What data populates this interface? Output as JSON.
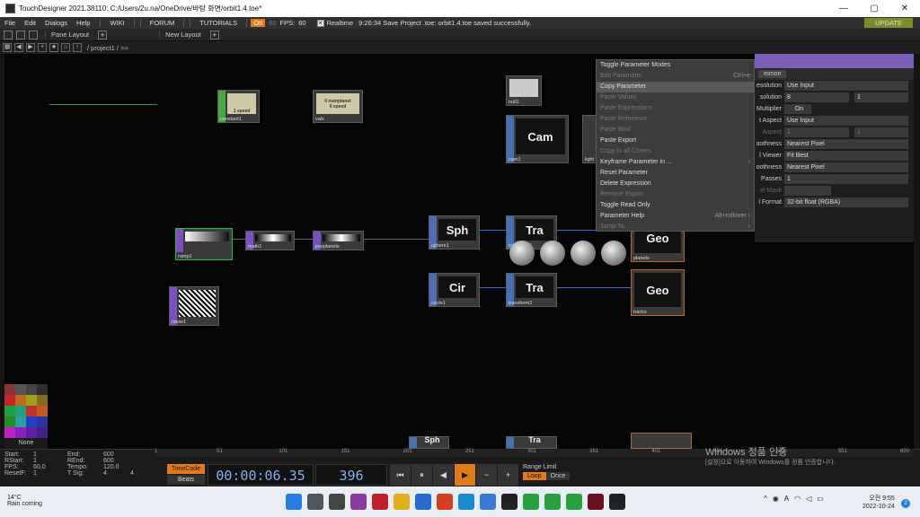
{
  "window": {
    "title": "TouchDesigner 2021.38110: C:/Users/2u.na/OneDrive/바탕 화면/orbit1.4.toe*"
  },
  "menu": {
    "items": [
      "File",
      "Edit",
      "Dialogs",
      "Help"
    ],
    "links": [
      "WIKI",
      "FORUM",
      "TUTORIALS"
    ],
    "oii": "OII",
    "fps_left": "60",
    "fps_label": "FPS:",
    "fps_value": "60",
    "realtime": "Realtime",
    "status": "9:26:34 Save Project .toe: orbit1.4.toe saved successfully.",
    "update": "UPDATE"
  },
  "panebar": {
    "pane_layout": "Pane Layout",
    "new_layout": "New Layout"
  },
  "pathbar": {
    "path": "/ project1 / >>"
  },
  "nodes": {
    "constant": "constant1",
    "vals": "vals",
    "null": "null1",
    "cam_thumb": "Cam",
    "cam": "cam1",
    "light": "light",
    "ramp": "ramp1",
    "math": "math1",
    "posplanets": "posplanets",
    "sph_thumb": "Sph",
    "sphere": "sphere1",
    "tra_thumb": "Tra",
    "transform1": "transform1",
    "geo_thumb": "Geo",
    "planets": "planets",
    "noise": "noise1",
    "cir_thumb": "Cir",
    "circle": "circle1",
    "transform2": "transform2",
    "tracks": "tracks",
    "constant_p1": "1 speed",
    "vals_p1": "0 numplanet",
    "vals_p2": "0 speed"
  },
  "context_menu": [
    {
      "label": "Toggle Parameter Modes",
      "enabled": true,
      "shortcut": ""
    },
    {
      "label": "Edit Parameter",
      "enabled": false,
      "shortcut": "Ctrl+e"
    },
    {
      "label": "Copy Parameter",
      "enabled": true,
      "shortcut": ""
    },
    {
      "label": "Paste Values",
      "enabled": false,
      "shortcut": ""
    },
    {
      "label": "Paste Expressions",
      "enabled": false,
      "shortcut": ""
    },
    {
      "label": "Paste Reference",
      "enabled": false,
      "shortcut": ""
    },
    {
      "label": "Paste Bind",
      "enabled": false,
      "shortcut": ""
    },
    {
      "label": "Paste Export",
      "enabled": true,
      "shortcut": ""
    },
    {
      "label": "Copy to all Clones",
      "enabled": false,
      "shortcut": ""
    },
    {
      "label": "Keyframe Parameter in ...",
      "enabled": true,
      "shortcut": "›"
    },
    {
      "label": "Reset Parameter",
      "enabled": true,
      "shortcut": ""
    },
    {
      "label": "Delete Expression",
      "enabled": true,
      "shortcut": ""
    },
    {
      "label": "Remove Export",
      "enabled": false,
      "shortcut": ""
    },
    {
      "label": "Toggle Read Only",
      "enabled": true,
      "shortcut": ""
    },
    {
      "label": "Parameter Help",
      "enabled": true,
      "shortcut": "Alt+rollover ›"
    },
    {
      "label": "Jump To...",
      "enabled": false,
      "shortcut": "›"
    }
  ],
  "params": {
    "tab": "mmon",
    "rows": [
      {
        "label": "esolution",
        "value": "Use Input",
        "enabled": true
      },
      {
        "label": "solution",
        "value": "8",
        "value2": "1",
        "enabled": true
      },
      {
        "label": "Multiplier",
        "value": "On",
        "enabled": true
      },
      {
        "label": "t Aspect",
        "value": "Use Input",
        "enabled": true
      },
      {
        "label": "Aspect",
        "value": "1",
        "value2": "1",
        "enabled": false
      },
      {
        "label": "oothness",
        "value": "Nearest Pixel",
        "enabled": true
      },
      {
        "label": "l Viewer",
        "value": "Fit Best",
        "enabled": true
      },
      {
        "label": "oothness",
        "value": "Nearest Pixel",
        "enabled": true
      },
      {
        "label": "Passes",
        "value": "1",
        "enabled": true
      },
      {
        "label": "el Mask",
        "value": "",
        "enabled": false
      },
      {
        "label": "l Format",
        "value": "32-bit float (RGBA)",
        "enabled": true
      }
    ]
  },
  "swatches": {
    "colors": [
      "#8a3434",
      "#555555",
      "#444444",
      "#2e2e2e",
      "#c02828",
      "#c06a1e",
      "#a0a020",
      "#8a6a20",
      "#20a040",
      "#20a080",
      "#c03030",
      "#c05a20",
      "#2a8a2a",
      "#2aa0a0",
      "#2040c0",
      "#3030a0",
      "#c020c0",
      "#8a20c0",
      "#6020a0",
      "#402080"
    ],
    "none_label": "None"
  },
  "timeinfo": {
    "start_label": "Start:",
    "start": "1",
    "end_label": "End:",
    "end": "600",
    "rstart_label": "RStart:",
    "rstart": "1",
    "rend_label": "REnd:",
    "rend": "600",
    "fps_label": "FPS:",
    "fps": "60.0",
    "tempo_label": "Tempo:",
    "tempo": "120.0",
    "resetf_label": "ResetF:",
    "resetf": "1",
    "tsig_label": "T Sig:",
    "tsig_a": "4",
    "tsig_b": "4"
  },
  "ruler": [
    "1",
    "51",
    "101",
    "151",
    "201",
    "251",
    "301",
    "351",
    "401",
    "451",
    "501",
    "551",
    "600"
  ],
  "transport": {
    "timecode_btn": "TimeCode",
    "beats_btn": "Beats",
    "timecode": "00:00:06.35",
    "frame": "396",
    "btns": [
      "⏮",
      "⏸",
      "◀",
      "▶",
      "−",
      "+"
    ],
    "range_label": "Range Limit",
    "loop": "Loop",
    "once": "Once"
  },
  "watermark": {
    "line1": "Windows 정품 인증",
    "line2": "[설정]으로 이동하여 Windows를 정품 인증합니다."
  },
  "taskbar": {
    "temp": "14°C",
    "weather": "Rain coming",
    "time": "오전 9:55",
    "date": "2022-10-24",
    "lang": "A",
    "badge": "2"
  }
}
